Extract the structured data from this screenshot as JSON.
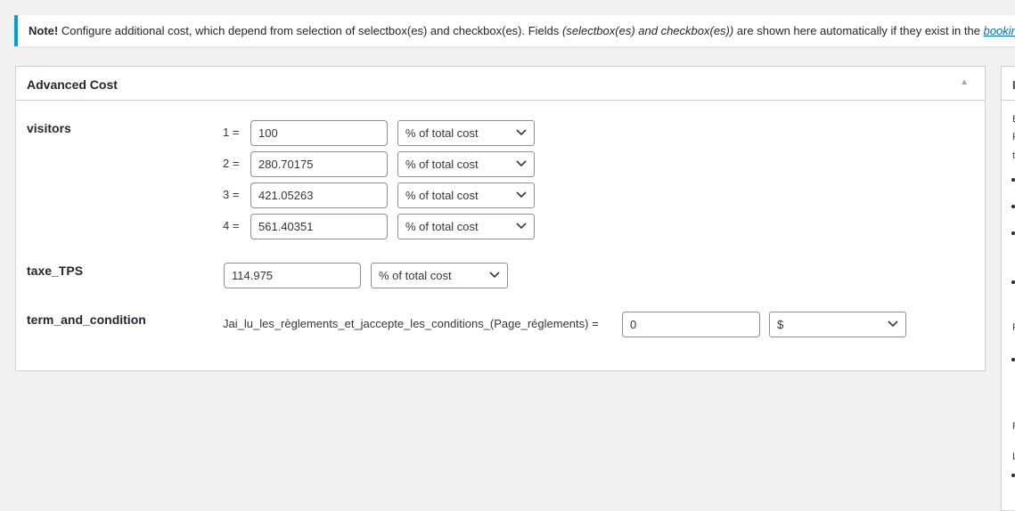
{
  "notice": {
    "strong": "Note!",
    "text1": " Configure additional cost, which depend from selection of selectbox(es) and checkbox(es). Fields ",
    "italic": "(selectbox(es) and checkbox(es))",
    "text2": " are shown here automatically if they exist in the ",
    "link": "booking fo"
  },
  "panel": {
    "title": "Advanced Cost",
    "toggle_icon": "triangle-up-icon"
  },
  "visitors": {
    "label": "visitors",
    "options": [
      {
        "num": "1 =",
        "value": "100",
        "type": "% of total cost"
      },
      {
        "num": "2 =",
        "value": "280.70175",
        "type": "% of total cost"
      },
      {
        "num": "3 =",
        "value": "421.05263",
        "type": "% of total cost"
      },
      {
        "num": "4 =",
        "value": "561.40351",
        "type": "% of total cost"
      }
    ]
  },
  "taxe": {
    "label": "taxe_TPS",
    "value": "114.975",
    "type": "% of total cost"
  },
  "term": {
    "label": "term_and_condition",
    "option_label": "Jai_lu_les_règlements_et_jaccepte_les_conditions_(Page_réglements) =",
    "value": "0",
    "type": "$"
  },
  "sidebar": {
    "letters": [
      "I",
      "E",
      "F",
      "t",
      "F",
      "F",
      "L"
    ]
  }
}
